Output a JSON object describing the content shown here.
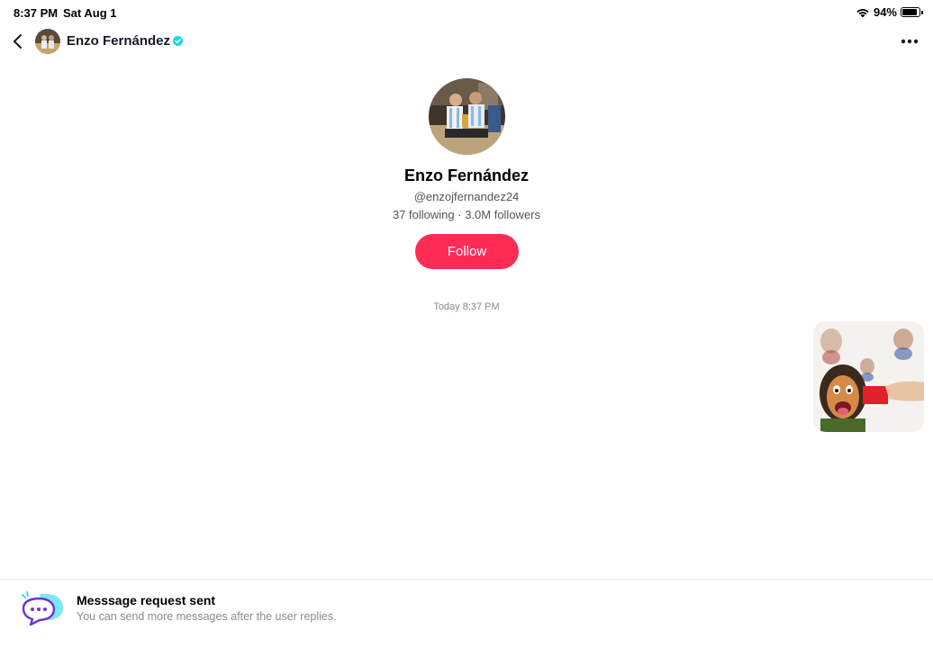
{
  "status_bar": {
    "time": "8:37 PM",
    "date": "Sat Aug 1",
    "battery": "94%"
  },
  "header": {
    "name": "Enzo Fernández",
    "verified_color": "#20d5ec"
  },
  "profile": {
    "name": "Enzo Fernández",
    "handle": "@enzojfernandez24",
    "stats": "37 following · 3.0M followers",
    "follow_label": "Follow",
    "accent": "#fe2c55"
  },
  "chat": {
    "timestamp": "Today 8:37 PM",
    "messages": [
      {
        "type": "sticker",
        "icon": "cartoon-sticker"
      }
    ]
  },
  "footer": {
    "title": "Messsage request sent",
    "subtitle": "You can send more messages after the user replies."
  }
}
